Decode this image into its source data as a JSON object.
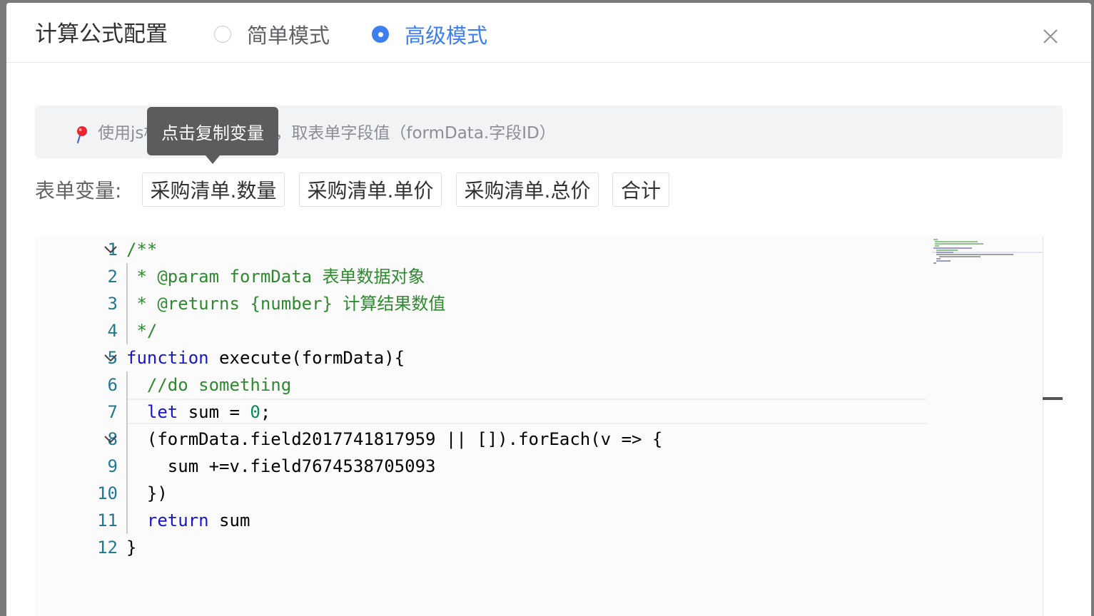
{
  "dialog": {
    "title": "计算公式配置",
    "modes": [
      {
        "label": "简单模式",
        "checked": false
      },
      {
        "label": "高级模式",
        "checked": true
      }
    ],
    "close_icon": "close-icon"
  },
  "tip": {
    "icon": "pin-icon",
    "text": "使用js构建任意计算规则，取表单字段值（formData.字段ID）"
  },
  "tooltip": {
    "text": "点击复制变量"
  },
  "variables": {
    "label": "表单变量:",
    "items": [
      "采购清单.数量",
      "采购清单.单价",
      "采购清单.总价",
      "合计"
    ]
  },
  "editor": {
    "line_numbers": [
      "1",
      "2",
      "3",
      "4",
      "5",
      "6",
      "7",
      "8",
      "9",
      "10",
      "11",
      "12"
    ],
    "lines": [
      "/**",
      " * @param formData 表单数据对象",
      " * @returns {number} 计算结果数值",
      " */",
      "function execute(formData){",
      "  //do something",
      "  let sum = 0;",
      "  (formData.field2017741817959 || []).forEach(v => {",
      "    sum +=v.field7674538705093",
      "  })",
      "  return sum",
      "}"
    ],
    "current_line": 7
  },
  "colors": {
    "accent": "#3e7ff0",
    "comment": "#2e8a2e",
    "keyword": "#1717c9",
    "number": "#0b8a5a",
    "line_number": "#237893"
  }
}
